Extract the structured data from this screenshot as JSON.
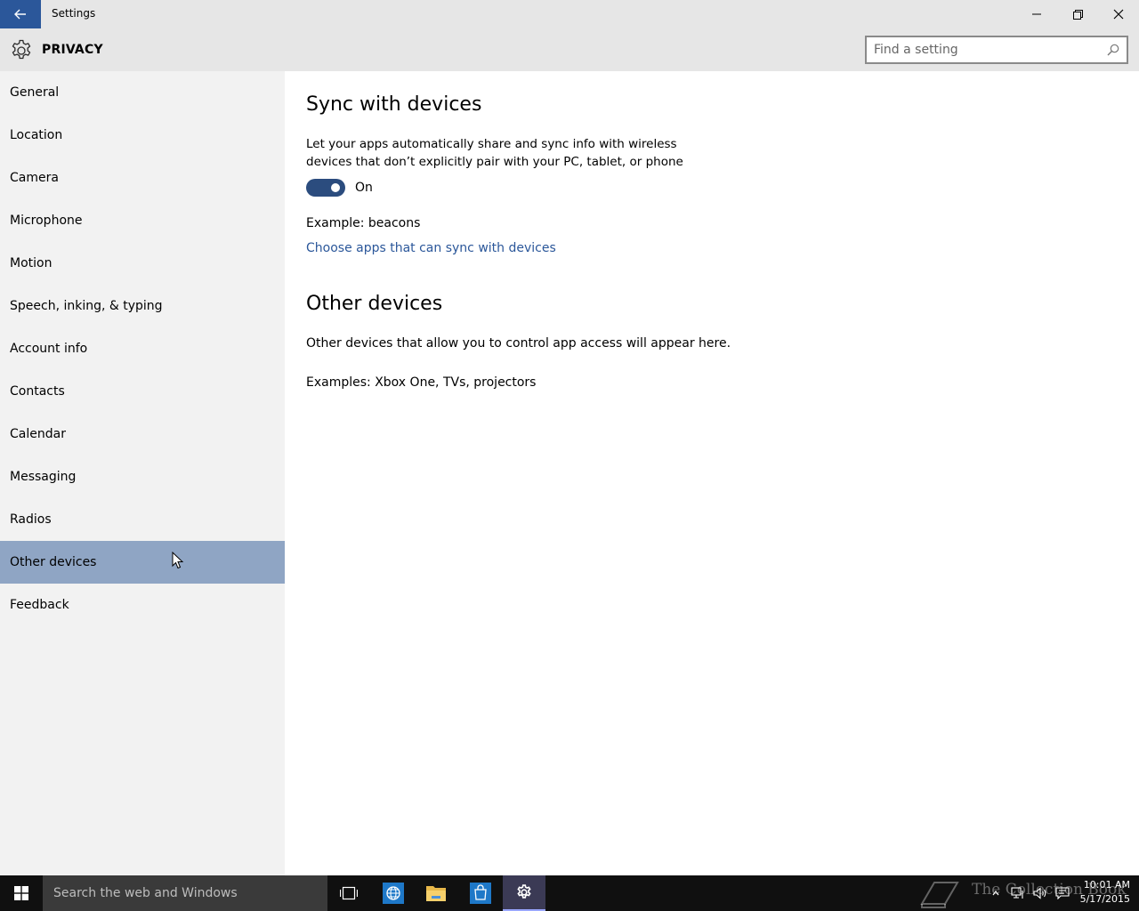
{
  "window": {
    "title": "Settings",
    "back_icon": "arrow-left-icon",
    "minimize_icon": "minimize-icon",
    "restore_icon": "restore-icon",
    "close_icon": "close-icon"
  },
  "header": {
    "section_title": "PRIVACY",
    "section_icon": "gear-icon",
    "search_placeholder": "Find a setting"
  },
  "sidebar": {
    "items": [
      {
        "label": "General"
      },
      {
        "label": "Location"
      },
      {
        "label": "Camera"
      },
      {
        "label": "Microphone"
      },
      {
        "label": "Motion"
      },
      {
        "label": "Speech, inking, & typing"
      },
      {
        "label": "Account info"
      },
      {
        "label": "Contacts"
      },
      {
        "label": "Calendar"
      },
      {
        "label": "Messaging"
      },
      {
        "label": "Radios"
      },
      {
        "label": "Other devices"
      },
      {
        "label": "Feedback"
      }
    ],
    "selected": "Other devices"
  },
  "main": {
    "sync_heading": "Sync with devices",
    "sync_desc_line1": "Let your apps automatically share and sync info with wireless",
    "sync_desc_line2": "devices that don’t explicitly pair with your PC, tablet, or phone",
    "toggle_state": "On",
    "example": "Example: beacons",
    "choose_link": "Choose apps that can sync with devices",
    "other_heading": "Other devices",
    "other_desc": "Other devices that allow you to control app access will appear here.",
    "other_examples": "Examples: Xbox One, TVs, projectors"
  },
  "taskbar": {
    "search_text": "Search the web and Windows",
    "watermark": "The Collection Book",
    "time": "10:01 AM",
    "date": "5/17/2015"
  },
  "colors": {
    "accent": "#2b579a",
    "selected_nav": "#8fa5c4",
    "sidebar_bg": "#f2f2f2",
    "titlebar_bg": "#e6e6e6",
    "taskbar_bg": "#101010"
  }
}
